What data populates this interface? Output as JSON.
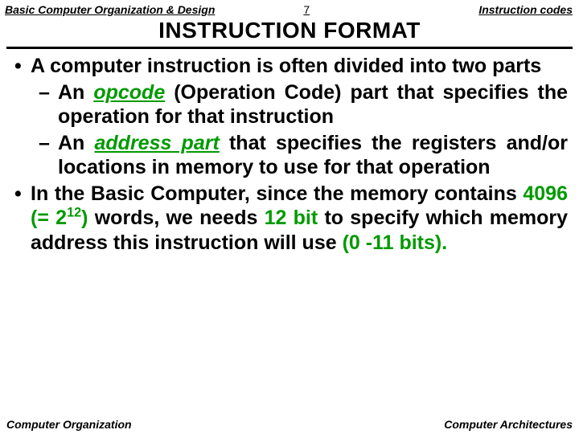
{
  "header": {
    "left": "Basic Computer Organization & Design",
    "page": "7",
    "right": "Instruction codes"
  },
  "title": "INSTRUCTION FORMAT",
  "bullets": {
    "b1": "A computer instruction is often divided into two parts",
    "b2a_pre": "An ",
    "b2a_opcode": "opcode",
    "b2a_post": " (Operation Code) part that specifies the operation for that instruction",
    "b2b_pre": "An ",
    "b2b_addr": "address part",
    "b2b_post": " that specifies the registers and/or locations in memory to use for that operation",
    "b3_pre": "In the Basic Computer, since the memory contains ",
    "b3_4096": "4096 (= 2",
    "b3_exp": "12",
    "b3_paren": ")",
    "b3_mid": " words, we needs ",
    "b3_12bit": "12 bit",
    "b3_mid2": " to specify which memory address this instruction will use ",
    "b3_bits": "(0 -11 bits)."
  },
  "footer": {
    "left": "Computer Organization",
    "right": "Computer Architectures"
  }
}
